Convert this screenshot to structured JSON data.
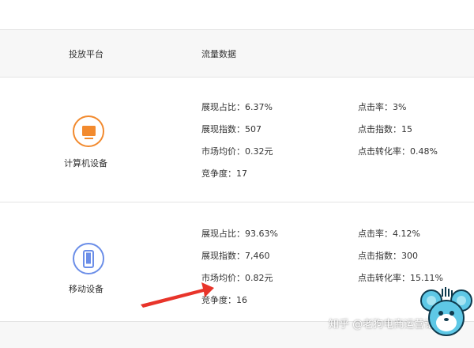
{
  "header": {
    "platform_label": "投放平台",
    "traffic_label": "流量数据"
  },
  "rows": [
    {
      "platform": "计算机设备",
      "icon": "monitor-icon",
      "accent": "#f28a2e",
      "left_metrics": [
        "展现占比：6.37%",
        "展现指数：507",
        "市场均价：0.32元",
        "竞争度：17"
      ],
      "right_metrics": [
        "点击率：3%",
        "点击指数：15",
        "点击转化率：0.48%"
      ]
    },
    {
      "platform": "移动设备",
      "icon": "smartphone-icon",
      "accent": "#6b8ee8",
      "left_metrics": [
        "展现占比：93.63%",
        "展现指数：7,460",
        "市场均价：0.82元",
        "竞争度：16"
      ],
      "right_metrics": [
        "点击率：4.12%",
        "点击指数：300",
        "点击转化率：15.11%"
      ]
    }
  ],
  "annotation": {
    "icon": "red-arrow-icon",
    "color": "#e8342a"
  },
  "watermark": {
    "text": "知乎 @老狗电商运营记"
  },
  "mascot": {
    "icon": "mouse-mascot-icon"
  }
}
